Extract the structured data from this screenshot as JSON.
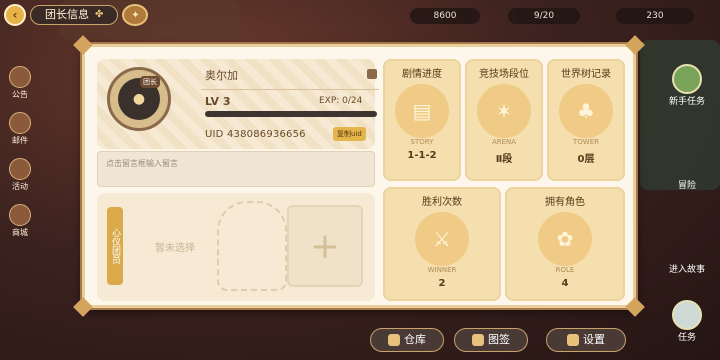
{
  "topbar": {
    "title": "团长信息"
  },
  "resources": [
    "8600",
    "9/20",
    "230"
  ],
  "sidenav": [
    {
      "label": "公告",
      "icon": "announcement-icon"
    },
    {
      "label": "邮件",
      "icon": "mail-icon"
    },
    {
      "label": "活动",
      "icon": "event-icon"
    },
    {
      "label": "商城",
      "icon": "shop-icon"
    }
  ],
  "right": {
    "quest": "新手任务",
    "adventure": "冒险",
    "story": "进入故事",
    "task": "任务"
  },
  "profile": {
    "avatar_tag": "团长",
    "name": "奥尔加",
    "level": "LV 3",
    "exp": "EXP: 0/24",
    "exp_fraction": 0,
    "uid": "UID 438086936656",
    "copy": "复制uid"
  },
  "message": {
    "placeholder": "点击留言框输入留言"
  },
  "team": {
    "label": "心仪团员",
    "empty": "暂未选择"
  },
  "stats": [
    {
      "title": "剧情进度",
      "art": "STORY",
      "value": "1-1-2",
      "icon": "book-icon"
    },
    {
      "title": "竞技场段位",
      "art": "ARENA",
      "value": "Ⅱ段",
      "icon": "arena-icon"
    },
    {
      "title": "世界树记录",
      "art": "TOWER",
      "value": "0层",
      "icon": "tree-icon"
    },
    {
      "title": "胜利次数",
      "art": "WINNER",
      "value": "2",
      "icon": "swords-icon"
    },
    {
      "title": "拥有角色",
      "art": "ROLE",
      "value": "4",
      "icon": "rabbit-icon"
    }
  ],
  "bottom": {
    "warehouse": "仓库",
    "collection": "图签",
    "settings": "设置"
  }
}
